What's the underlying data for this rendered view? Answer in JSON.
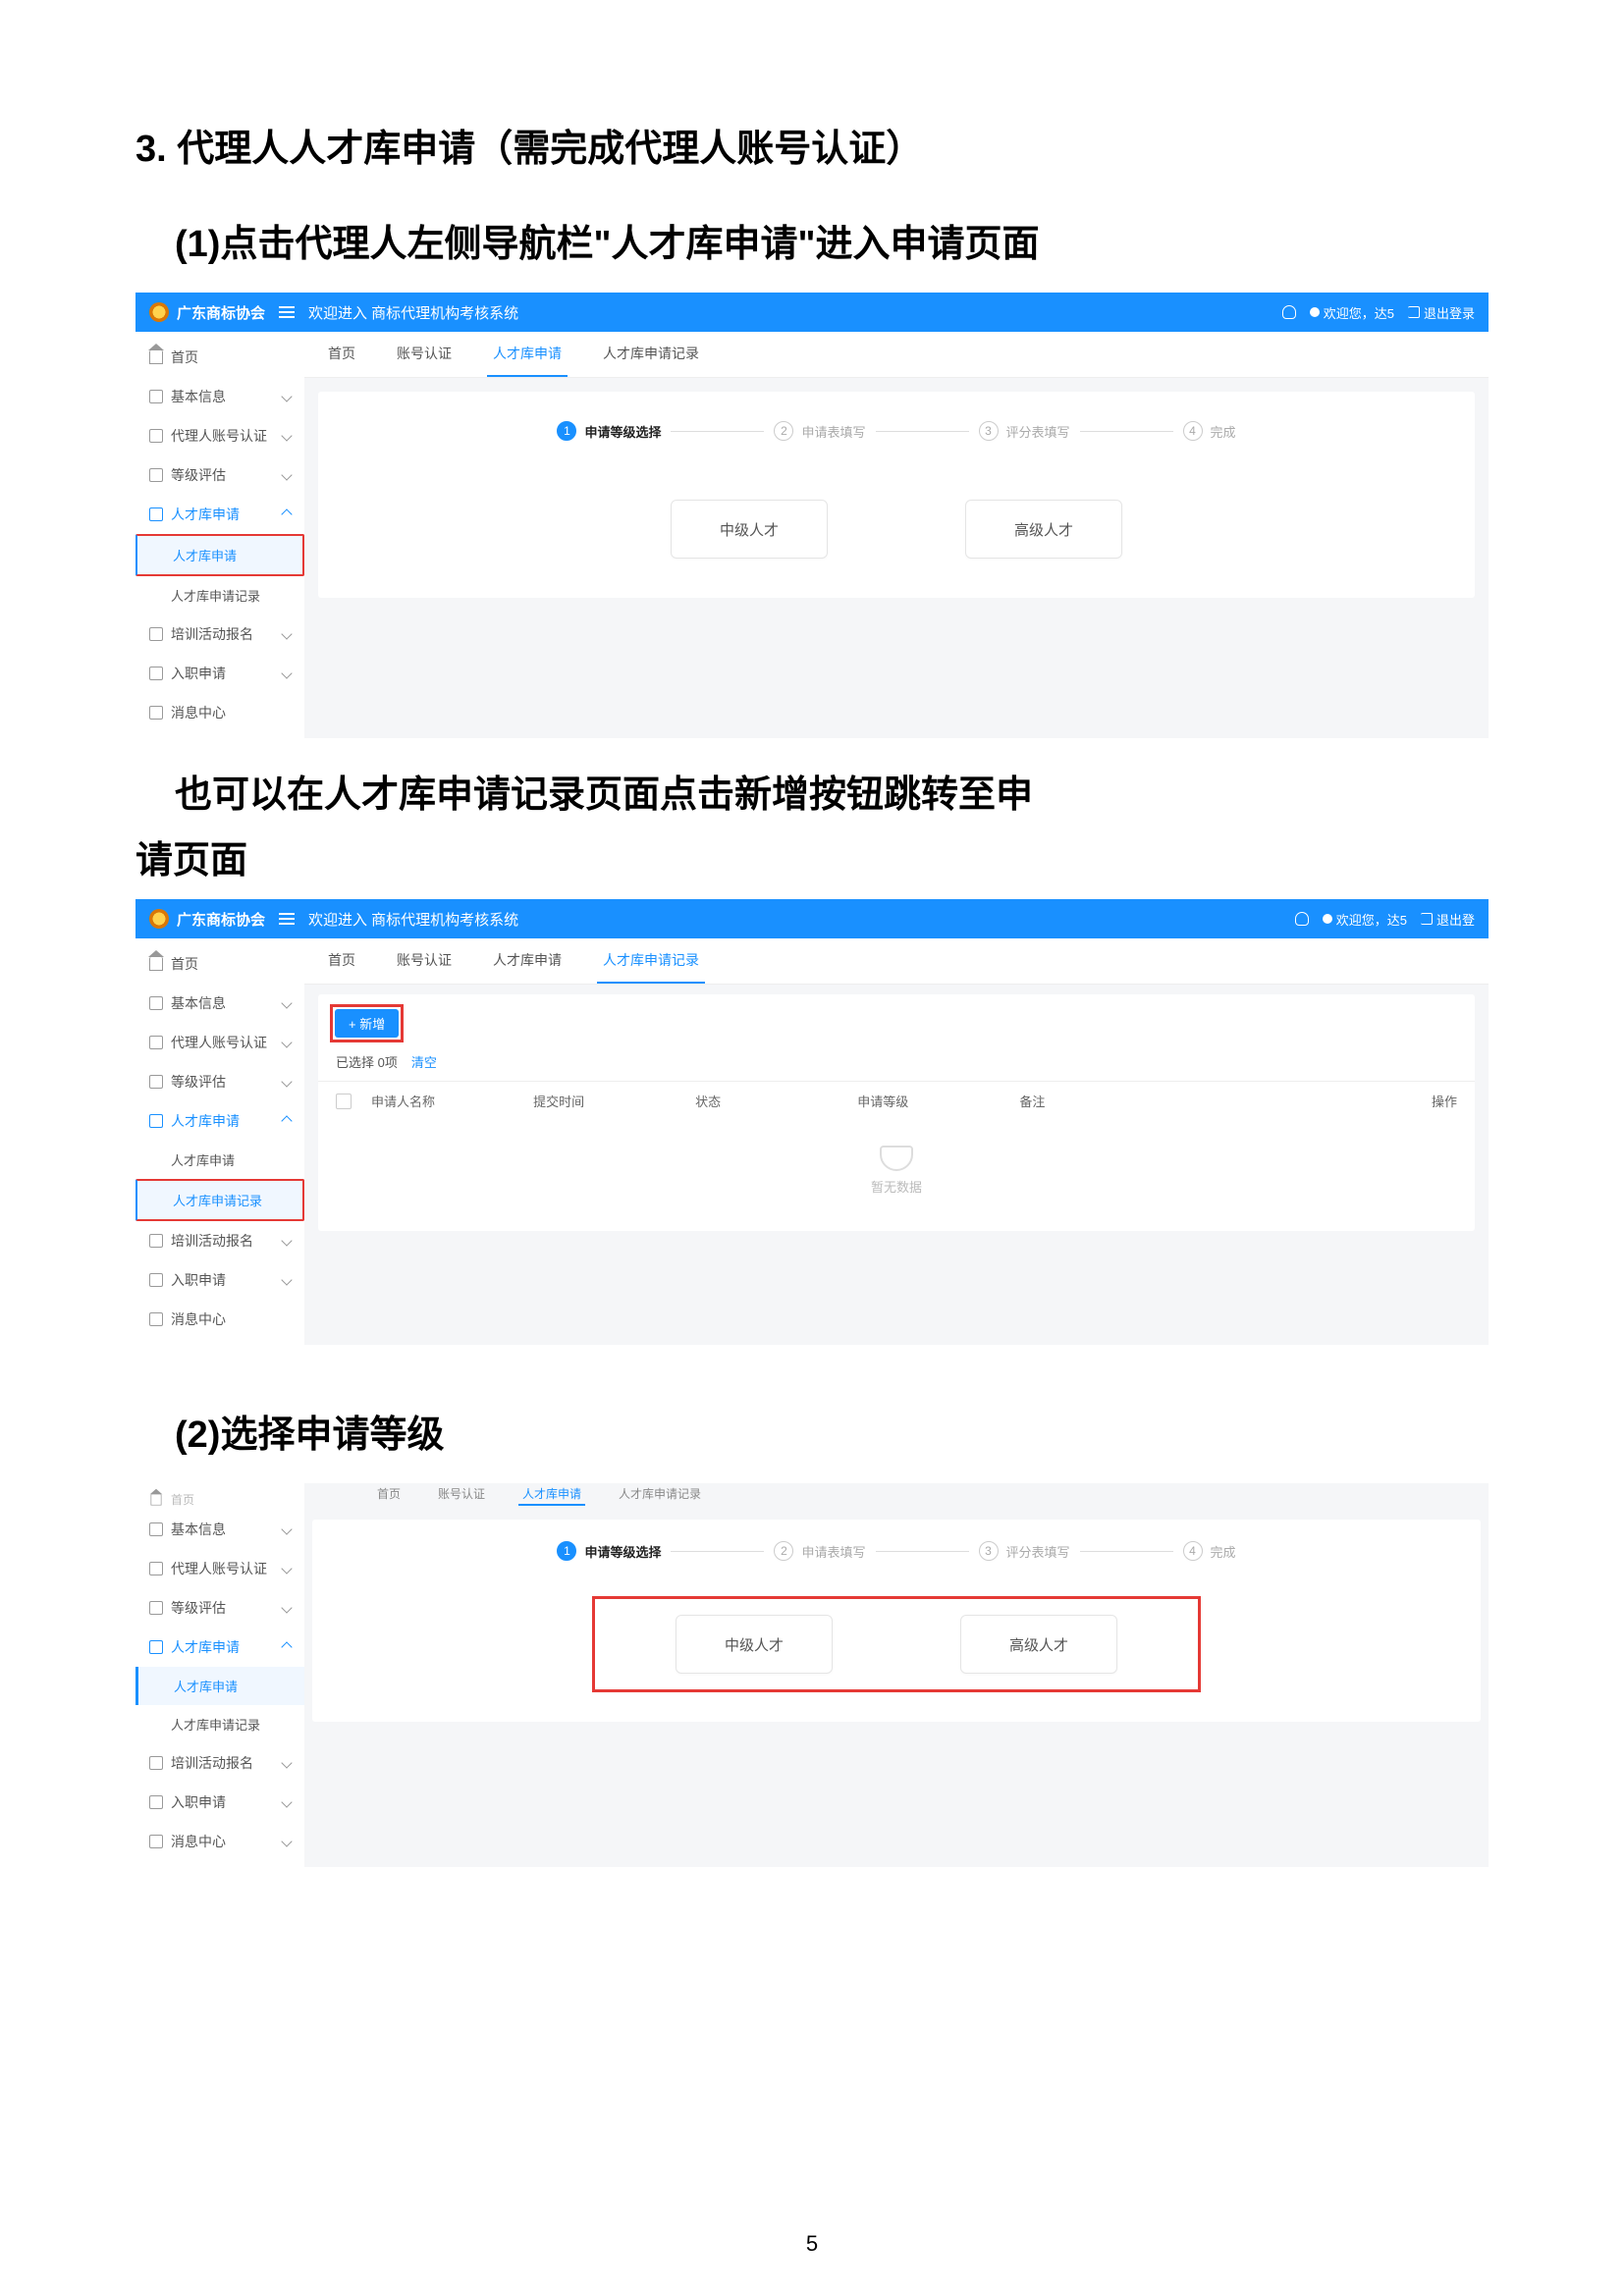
{
  "headings": {
    "h3": "3.  代理人人才库申请（需完成代理人账号认证）",
    "h4_1": "(1)点击代理人左侧导航栏\"人才库申请\"进入申请页面",
    "mid_para1": "也可以在人才库申请记录页面点击新增按钮跳转至申",
    "mid_para2": "请页面",
    "h4_2": "(2)选择申请等级"
  },
  "page_number": "5",
  "shot1": {
    "brand": "广东商标协会",
    "welcome": "欢迎进入 商标代理机构考核系统",
    "user_greeting": "欢迎您，达5",
    "logout": "退出登录",
    "sidebar": [
      {
        "label": "首页",
        "expand": false
      },
      {
        "label": "基本信息",
        "expand": true
      },
      {
        "label": "代理人账号认证",
        "expand": true
      },
      {
        "label": "等级评估",
        "expand": true
      },
      {
        "label": "人才库申请",
        "expand": true,
        "active": true,
        "subs": [
          {
            "label": "人才库申请",
            "active": true
          },
          {
            "label": "人才库申请记录",
            "active": false
          }
        ]
      },
      {
        "label": "培训活动报名",
        "expand": true
      },
      {
        "label": "入职申请",
        "expand": true
      },
      {
        "label": "消息中心",
        "expand": false
      }
    ],
    "tabs": [
      "首页",
      "账号认证",
      "人才库申请",
      "人才库申请记录"
    ],
    "active_tab": "人才库申请",
    "steps": [
      {
        "num": "1",
        "label": "申请等级选择",
        "active": true
      },
      {
        "num": "2",
        "label": "申请表填写"
      },
      {
        "num": "3",
        "label": "评分表填写"
      },
      {
        "num": "4",
        "label": "完成"
      }
    ],
    "options": [
      "中级人才",
      "高级人才"
    ]
  },
  "shot2": {
    "brand": "广东商标协会",
    "welcome": "欢迎进入 商标代理机构考核系统",
    "user_greeting": "欢迎您，达5",
    "logout": "退出登",
    "sidebar": [
      {
        "label": "首页",
        "expand": false
      },
      {
        "label": "基本信息",
        "expand": true
      },
      {
        "label": "代理人账号认证",
        "expand": true
      },
      {
        "label": "等级评估",
        "expand": true
      },
      {
        "label": "人才库申请",
        "expand": true,
        "active": true,
        "subs": [
          {
            "label": "人才库申请",
            "active": false
          },
          {
            "label": "人才库申请记录",
            "active": true
          }
        ]
      },
      {
        "label": "培训活动报名",
        "expand": true
      },
      {
        "label": "入职申请",
        "expand": true
      },
      {
        "label": "消息中心",
        "expand": false
      }
    ],
    "tabs": [
      "首页",
      "账号认证",
      "人才库申请",
      "人才库申请记录"
    ],
    "active_tab": "人才库申请记录",
    "btn_new": "+ 新增",
    "selected_text": "已选择 0项",
    "clear_text": "清空",
    "columns": [
      "申请人名称",
      "提交时间",
      "状态",
      "申请等级",
      "备注",
      "操作"
    ],
    "empty": "暂无数据"
  },
  "shot3": {
    "sidebar": [
      {
        "label": "首页",
        "expand": false
      },
      {
        "label": "基本信息",
        "expand": true
      },
      {
        "label": "代理人账号认证",
        "expand": true
      },
      {
        "label": "等级评估",
        "expand": true
      },
      {
        "label": "人才库申请",
        "expand": true,
        "active": true,
        "subs": [
          {
            "label": "人才库申请",
            "active": true
          },
          {
            "label": "人才库申请记录",
            "active": false
          }
        ]
      },
      {
        "label": "培训活动报名",
        "expand": true
      },
      {
        "label": "入职申请",
        "expand": true
      },
      {
        "label": "消息中心",
        "expand": false
      }
    ],
    "tabs": [
      "首页",
      "账号认证",
      "人才库申请",
      "人才库申请记录"
    ],
    "active_tab": "人才库申请",
    "steps": [
      {
        "num": "1",
        "label": "申请等级选择",
        "active": true
      },
      {
        "num": "2",
        "label": "申请表填写"
      },
      {
        "num": "3",
        "label": "评分表填写"
      },
      {
        "num": "4",
        "label": "完成"
      }
    ],
    "options": [
      "中级人才",
      "高级人才"
    ]
  }
}
